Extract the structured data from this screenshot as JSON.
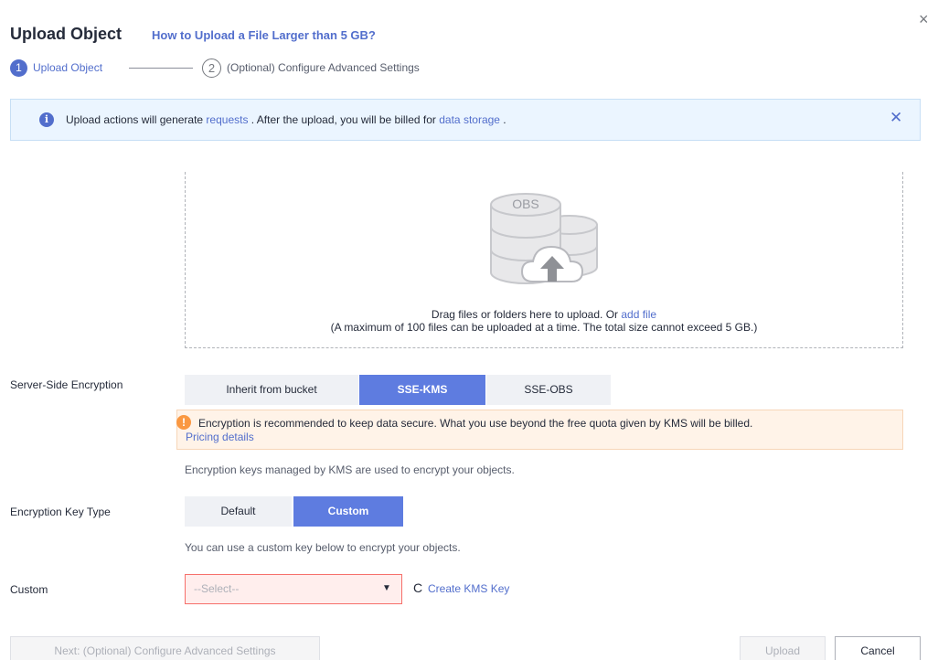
{
  "header": {
    "title": "Upload Object",
    "title_link": "How to Upload a File Larger than 5 GB?",
    "close_icon": "×"
  },
  "steps": [
    {
      "number": "1",
      "label": "Upload Object",
      "active": true
    },
    {
      "number": "2",
      "label": "(Optional) Configure Advanced Settings",
      "active": false
    }
  ],
  "banner": {
    "icon": "info-icon",
    "text_before": "Upload actions will generate ",
    "link1": "requests",
    "text_middle": " . After the upload, you will be billed for ",
    "link2": "data storage",
    "text_after": " .",
    "close_icon": "✕"
  },
  "dropzone": {
    "graphic_label": "OBS",
    "line1_text": "Drag files or folders here to upload. Or ",
    "line1_link": "add file",
    "line2": "(A maximum of 100 files can be uploaded at a time. The total size cannot exceed 5 GB.)"
  },
  "encryption": {
    "label": "Server-Side Encryption",
    "options": [
      "Inherit from bucket",
      "SSE-KMS",
      "SSE-OBS"
    ],
    "selected": "SSE-KMS",
    "warning_icon": "!",
    "warning_text": "Encryption is recommended to keep data secure. What you use beyond the free quota given by KMS will be billed.",
    "warning_link": "Pricing details",
    "helper": "Encryption keys managed by KMS are used to encrypt your objects."
  },
  "key_type": {
    "label": "Encryption Key Type",
    "options": [
      "Default",
      "Custom"
    ],
    "selected": "Custom",
    "helper": "You can use a custom key below to encrypt your objects."
  },
  "custom": {
    "label": "Custom",
    "placeholder": "--Select--",
    "caret": "▼",
    "refresh_icon": "C",
    "create_link": "Create KMS Key"
  },
  "footer": {
    "next_label": "Next: (Optional) Configure Advanced Settings",
    "upload_label": "Upload",
    "cancel_label": "Cancel"
  },
  "colors": {
    "accent": "#526ecc",
    "selected_segment": "#5e7ce0",
    "info_bg": "#ebf5ff",
    "warning": "#fa9841",
    "error_border": "#f66f6a"
  }
}
